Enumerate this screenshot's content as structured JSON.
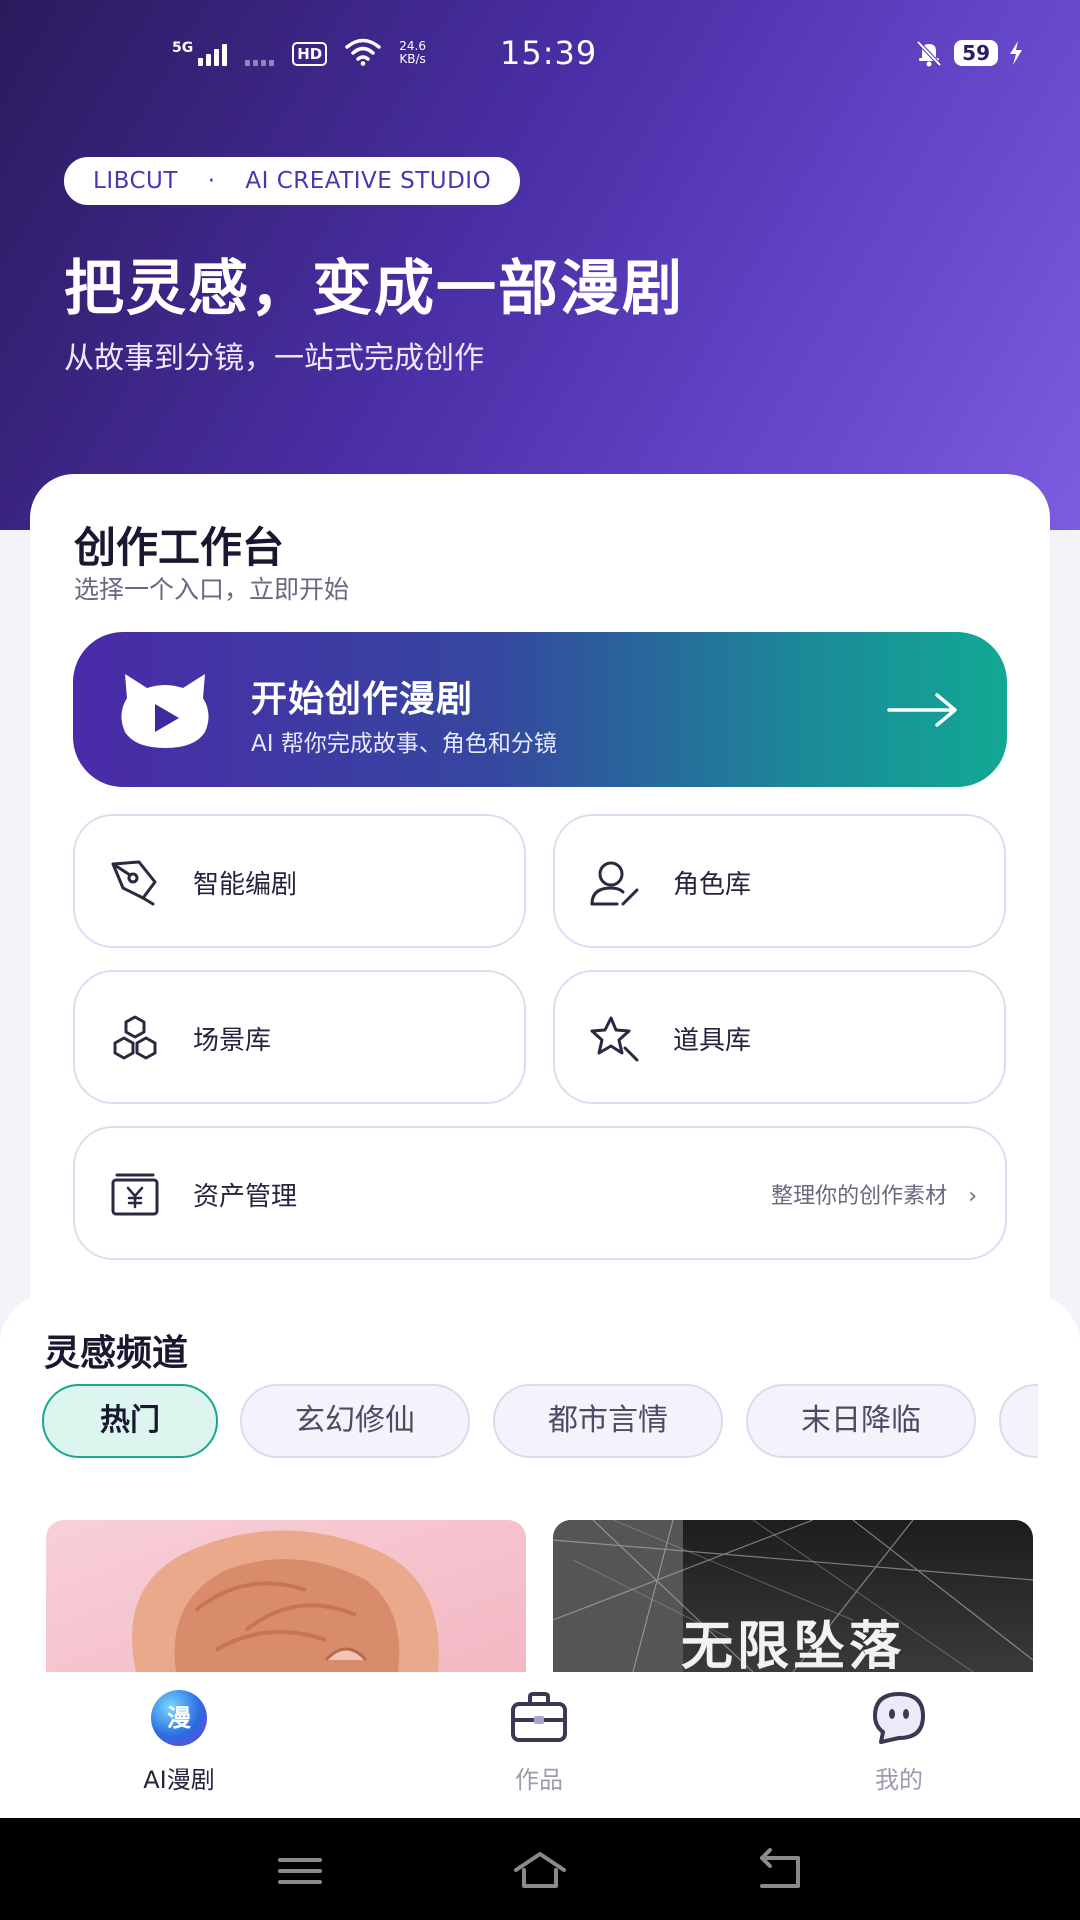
{
  "status_bar": {
    "network_tag": "5G",
    "hd": "HD",
    "speed_value": "24.6",
    "speed_unit": "KB/s",
    "time": "15:39",
    "battery": "59"
  },
  "hero": {
    "badge_brand": "LIBCUT",
    "badge_sep": "·",
    "badge_studio": "AI CREATIVE STUDIO",
    "title": "把灵感，变成一部漫剧",
    "subtitle": "从故事到分镜，一站式完成创作"
  },
  "workbench": {
    "title": "创作工作台",
    "subtitle": "选择一个入口，立即开始",
    "cta": {
      "title": "开始创作漫剧",
      "subtitle": "AI 帮你完成故事、角色和分镜"
    },
    "tiles": [
      {
        "label": "智能编剧",
        "icon": "pen-nib-icon"
      },
      {
        "label": "角色库",
        "icon": "user-edit-icon"
      },
      {
        "label": "场景库",
        "icon": "hexagons-icon"
      },
      {
        "label": "道具库",
        "icon": "star-wand-icon"
      }
    ],
    "assets": {
      "label": "资产管理",
      "hint": "整理你的创作素材",
      "chevron": "›",
      "icon": "yen-box-icon"
    }
  },
  "inspiration": {
    "title": "灵感频道",
    "chips": [
      "热门",
      "玄幻修仙",
      "都市言情",
      "末日降临"
    ],
    "active_chip": "热门",
    "cards": [
      {
        "title": ""
      },
      {
        "title": "无限坠落"
      }
    ]
  },
  "tabbar": {
    "tabs": [
      {
        "label": "AI漫剧",
        "orb_text": "漫",
        "active": true
      },
      {
        "label": "作品",
        "icon": "briefcase-icon",
        "active": false
      },
      {
        "label": "我的",
        "icon": "chat-face-icon",
        "active": false
      }
    ]
  },
  "colors": {
    "hero_start": "#2b1a5c",
    "hero_end": "#7d5ce0",
    "accent_teal": "#18a88e",
    "accent_purple": "#4b35b5"
  }
}
